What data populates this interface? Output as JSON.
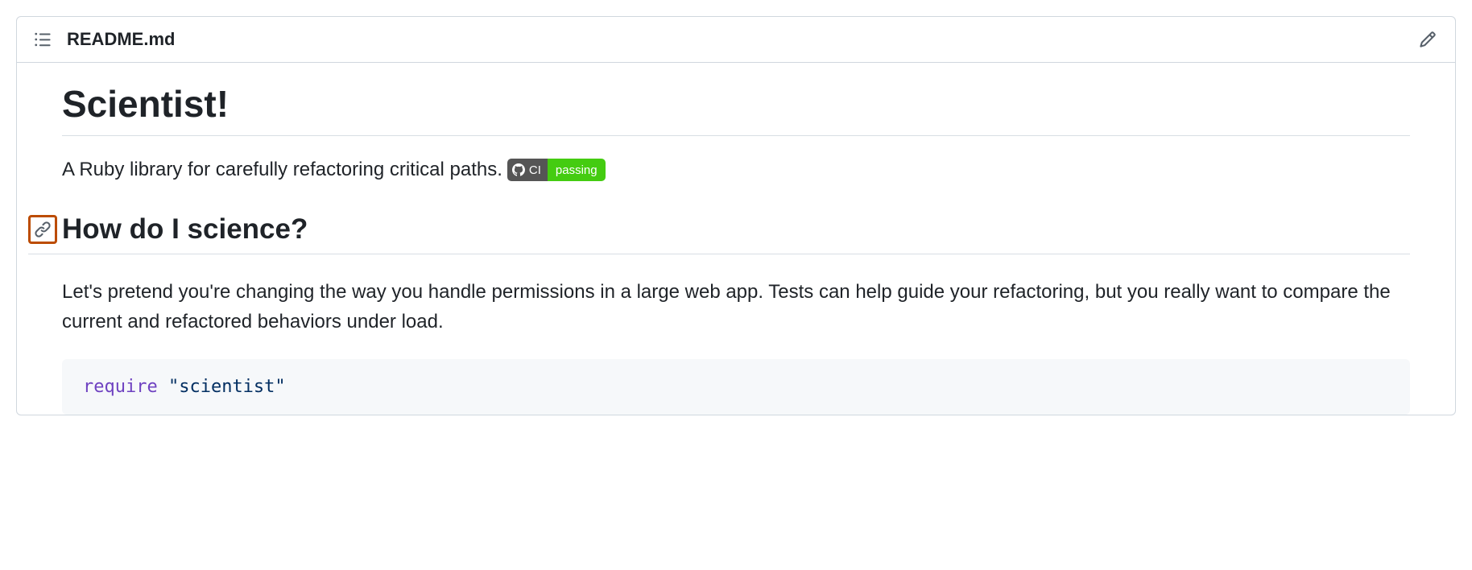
{
  "header": {
    "filename": "README.md"
  },
  "content": {
    "title": "Scientist!",
    "description": "A Ruby library for carefully refactoring critical paths.",
    "badge": {
      "label": "CI",
      "status": "passing"
    },
    "section_heading": "How do I science?",
    "section_body": "Let's pretend you're changing the way you handle permissions in a large web app. Tests can help guide your refactoring, but you really want to compare the current and refactored behaviors under load.",
    "code": {
      "keyword": "require",
      "string": "\"scientist\""
    }
  }
}
